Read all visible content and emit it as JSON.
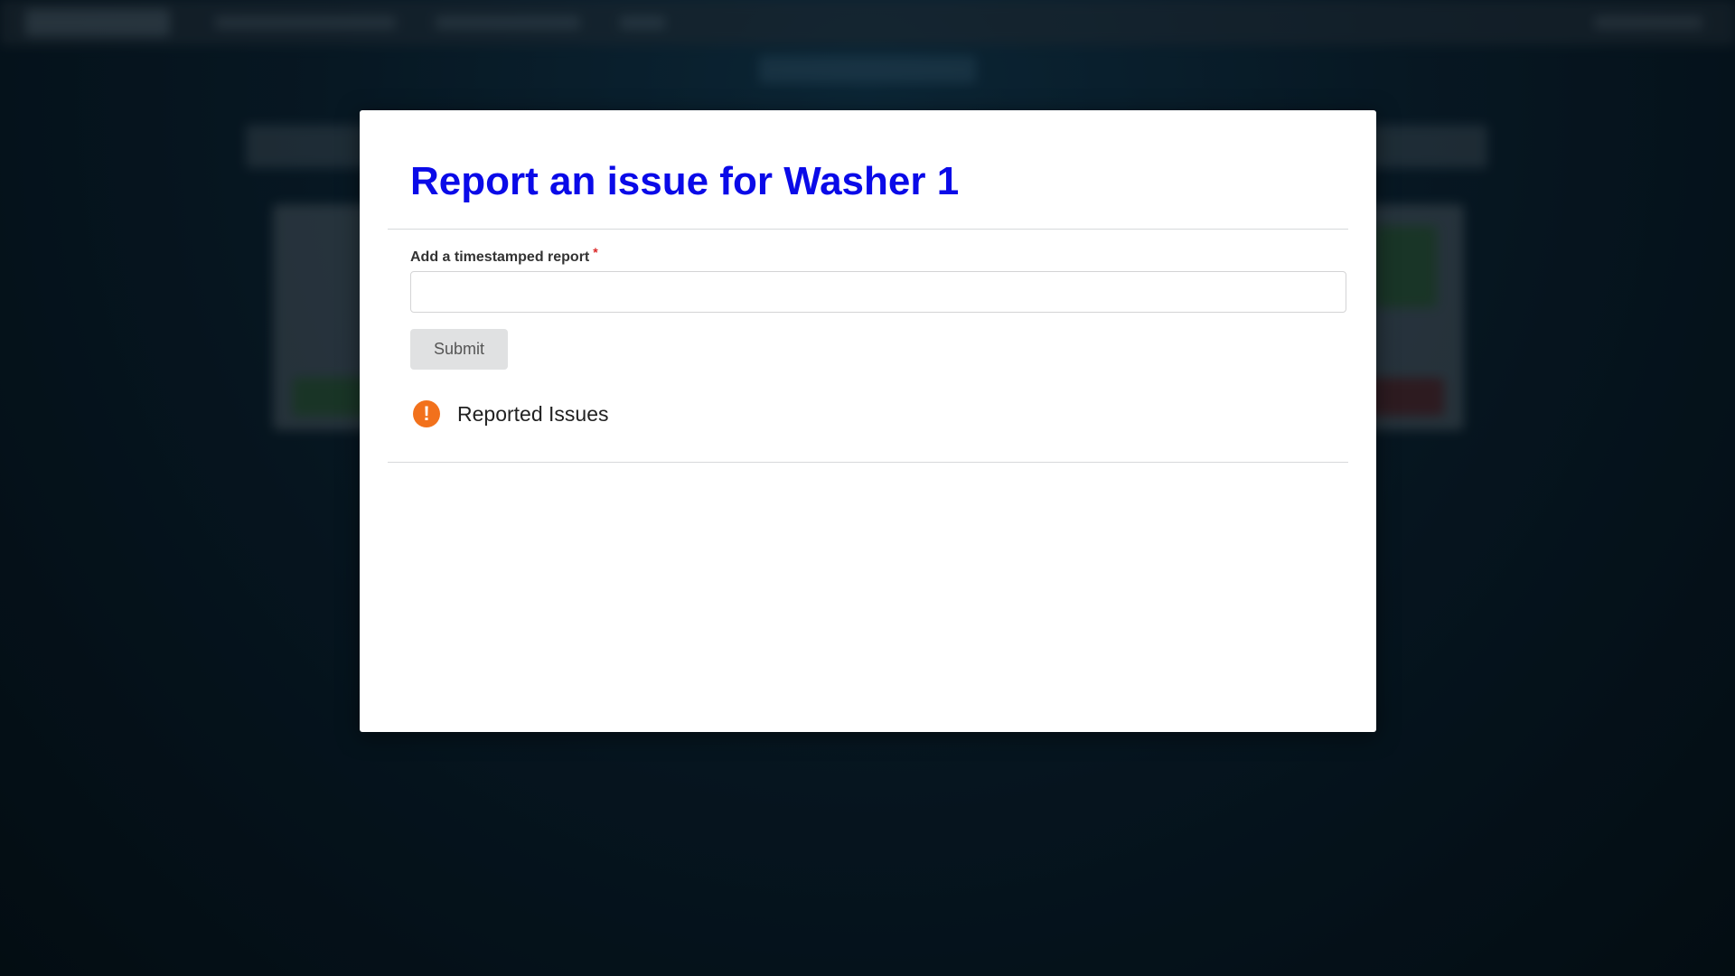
{
  "modal": {
    "title": "Report an issue for Washer 1",
    "report_field": {
      "label": "Add a timestamped report",
      "required_marker": "*",
      "value": "",
      "placeholder": ""
    },
    "submit_label": "Submit",
    "issues_section": {
      "icon": "exclamation-circle-icon",
      "icon_glyph": "!",
      "title": "Reported Issues",
      "items": []
    }
  },
  "colors": {
    "title": "#0a0ae8",
    "required": "#db2828",
    "issues_icon": "#f2711c",
    "submit_bg": "#e0e1e2"
  }
}
